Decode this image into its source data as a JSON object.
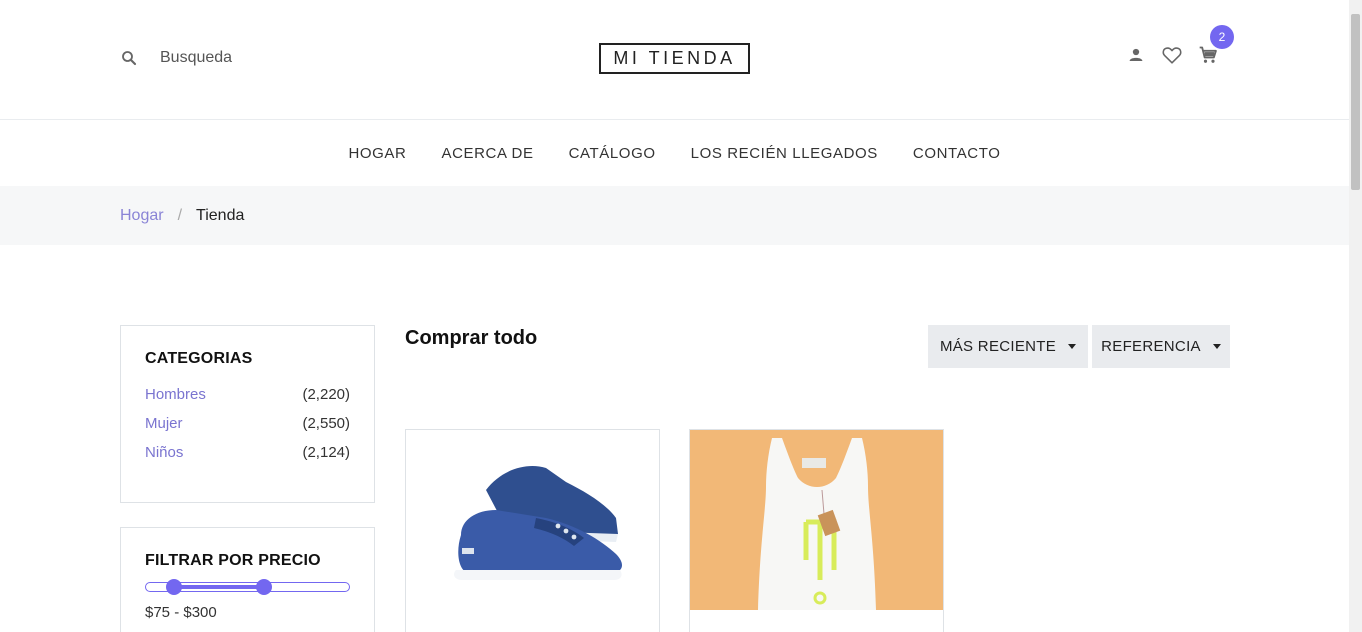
{
  "header": {
    "search_placeholder": "Busqueda",
    "logo": "MI TIENDA",
    "cart_count": "2"
  },
  "nav": {
    "items": [
      "HOGAR",
      "ACERCA DE",
      "CATÁLOGO",
      "LOS RECIÉN LLEGADOS",
      "CONTACTO"
    ]
  },
  "breadcrumb": {
    "home": "Hogar",
    "separator": "/",
    "current": "Tienda"
  },
  "sidebar": {
    "categories_title": "CATEGORIAS",
    "categories": [
      {
        "name": "Hombres",
        "count": "(2,220)"
      },
      {
        "name": "Mujer",
        "count": "(2,550)"
      },
      {
        "name": "Niños",
        "count": "(2,124)"
      }
    ],
    "price_title": "FILTRAR POR PRECIO",
    "price_range": "$75 - $300",
    "price_min_fraction": 0.14,
    "price_max_fraction": 0.58
  },
  "main": {
    "title": "Comprar todo",
    "sort_recent": "MÁS RECIENTE",
    "sort_reference": "REFERENCIA"
  },
  "colors": {
    "accent": "#7367f0",
    "link": "#8a84d6",
    "breadcrumb_bg": "#f6f7f8",
    "button_bg": "#e9ebee",
    "product2_bg": "#f2b877"
  },
  "icons": {
    "search": "search-icon",
    "user": "user-icon",
    "wishlist": "heart-icon",
    "cart": "cart-icon"
  }
}
